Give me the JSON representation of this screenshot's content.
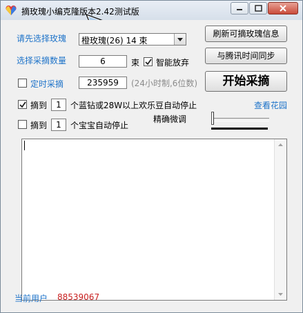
{
  "window": {
    "title": "摘玫瑰小编克隆版本2.42测试版"
  },
  "form": {
    "select_rose_label": "请先选择玫瑰",
    "rose_selected": "橙玫瑰(26) 14 束",
    "pick_count_label": "选择采摘数量",
    "pick_count_value": "6",
    "unit_bunch": "束",
    "smart_abandon_label": "智能放弃",
    "smart_abandon_checked": true,
    "timed_pick_label": "定时采摘",
    "timed_pick_checked": false,
    "timed_pick_value": "235959",
    "timed_pick_hint": "(24小时制,6位数)",
    "stop1_prefix": "摘到",
    "stop1_checked": true,
    "stop1_count": "1",
    "stop1_suffix": "个蓝钻或28W以上欢乐豆自动停止",
    "stop2_prefix": "摘到",
    "stop2_checked": false,
    "stop2_count": "1",
    "stop2_suffix": "个宝宝自动停止",
    "fine_tune_label": "精确微调"
  },
  "buttons": {
    "refresh": "刷新可摘玫瑰信息",
    "sync_time": "与腾讯时间同步",
    "start": "开始采摘"
  },
  "links": {
    "view_garden": "查看花园"
  },
  "status": {
    "user_label": "当前用户",
    "user_value": "88539067"
  },
  "colors": {
    "label_blue": "#1e73c9",
    "user_red": "#c81e1e"
  }
}
